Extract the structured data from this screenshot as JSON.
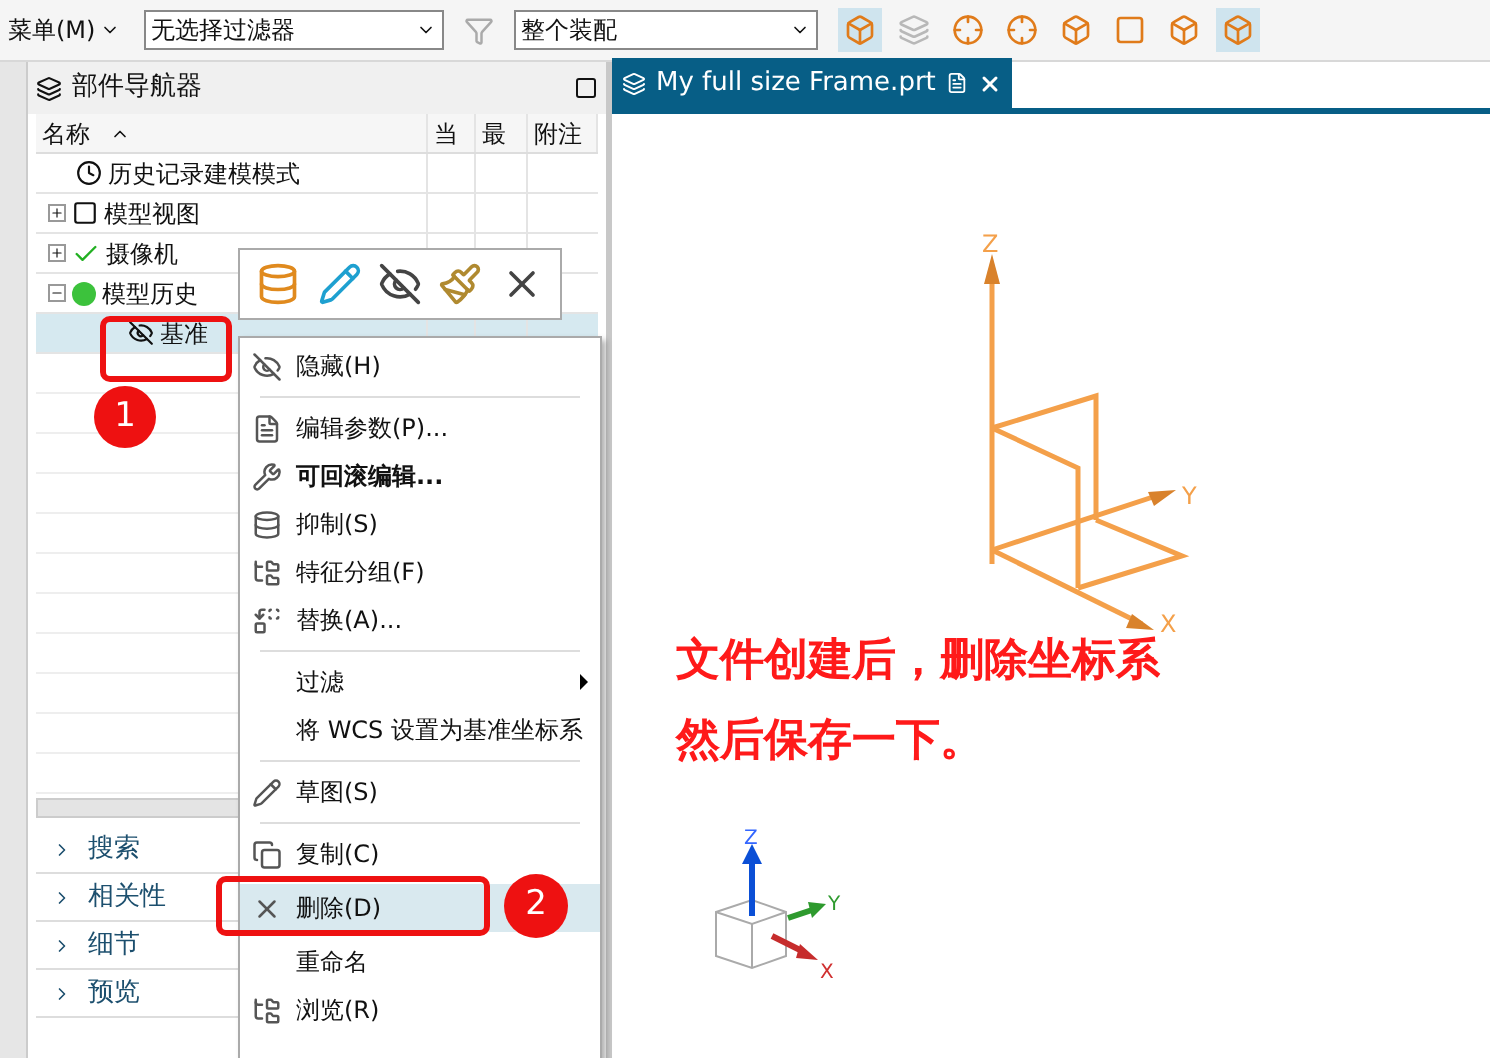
{
  "toolbar": {
    "menu_label": "菜单(M)",
    "selection_filter": {
      "value": "无选择过滤器"
    },
    "scope": {
      "value": "整个装配"
    },
    "icon_buttons": [
      {
        "selected": true,
        "disabled": false
      },
      {
        "selected": false,
        "disabled": true
      },
      {
        "selected": false,
        "disabled": false
      },
      {
        "selected": false,
        "disabled": false
      },
      {
        "selected": false,
        "disabled": false
      },
      {
        "selected": false,
        "disabled": false
      },
      {
        "selected": false,
        "disabled": false
      },
      {
        "selected": true,
        "disabled": false
      }
    ]
  },
  "navigator": {
    "title": "部件导航器",
    "columns": [
      "名称",
      "当",
      "最",
      "附注"
    ],
    "tree": [
      {
        "label": "历史记录建模模式",
        "selected": false
      },
      {
        "label": "模型视图",
        "expanded": false,
        "selected": false
      },
      {
        "label": "摄像机",
        "expanded": false,
        "selected": false
      },
      {
        "label": "模型历史",
        "expanded": true,
        "selected": false,
        "children": [
          {
            "label": "基准",
            "selected": true
          }
        ]
      }
    ],
    "sections": [
      {
        "label": "搜索",
        "expanded": false
      },
      {
        "label": "相关性",
        "expanded": false
      },
      {
        "label": "细节",
        "expanded": false
      },
      {
        "label": "预览",
        "expanded": false
      }
    ]
  },
  "context_menu": {
    "items": [
      {
        "kind": "item",
        "label": "隐藏(H)",
        "highlighted": false
      },
      {
        "kind": "separator"
      },
      {
        "kind": "item",
        "label": "编辑参数(P)...",
        "highlighted": false
      },
      {
        "kind": "item",
        "label": "可回滚编辑...",
        "highlighted": false,
        "bold": true
      },
      {
        "kind": "item",
        "label": "抑制(S)",
        "highlighted": false
      },
      {
        "kind": "item",
        "label": "特征分组(F)",
        "highlighted": false
      },
      {
        "kind": "item",
        "label": "替换(A)...",
        "highlighted": false
      },
      {
        "kind": "separator"
      },
      {
        "kind": "item",
        "label": "过滤",
        "highlighted": false,
        "submenu": true
      },
      {
        "kind": "item",
        "label": "将 WCS 设置为基准坐标系",
        "highlighted": false
      },
      {
        "kind": "separator"
      },
      {
        "kind": "item",
        "label": "草图(S)",
        "highlighted": false
      },
      {
        "kind": "separator"
      },
      {
        "kind": "item",
        "label": "复制(C)",
        "highlighted": false
      },
      {
        "kind": "item",
        "label": "删除(D)",
        "highlighted": true
      },
      {
        "kind": "item",
        "label": "重命名",
        "highlighted": false
      },
      {
        "kind": "item",
        "label": "浏览(R)",
        "highlighted": false
      }
    ]
  },
  "viewport": {
    "tab": {
      "title": "My full size Frame.prt",
      "selected": true
    },
    "csys_axes": [
      "Z",
      "Y",
      "X"
    ],
    "triad_axes": [
      "Z",
      "Y",
      "X"
    ],
    "note": [
      "文件创建后，删除坐标系",
      "然后保存一下。"
    ]
  },
  "callouts": [
    "1",
    "2"
  ]
}
